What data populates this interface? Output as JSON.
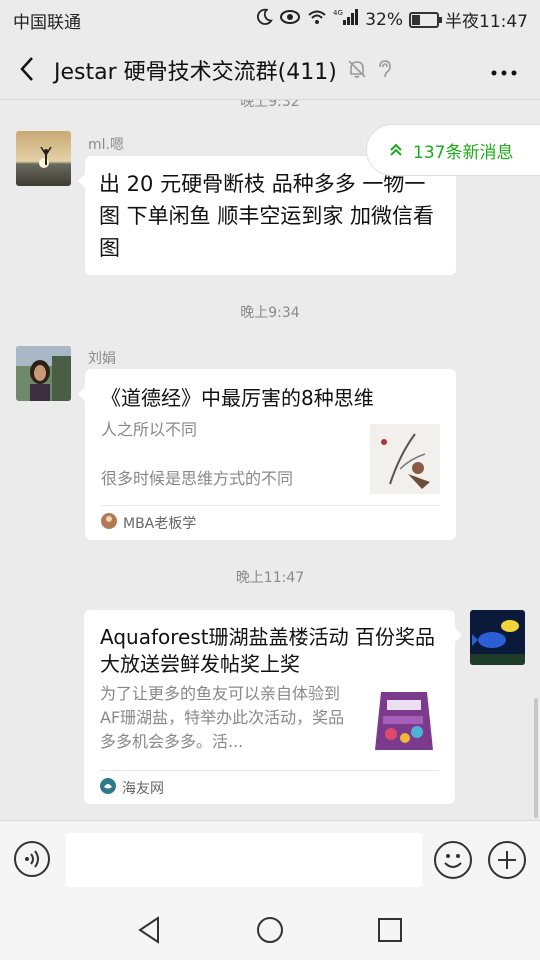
{
  "status_bar": {
    "carrier": "中国联通",
    "signal_label": "4G",
    "battery": "32%",
    "battery_level": 0.32,
    "time": "半夜11:47"
  },
  "header": {
    "title": "Jestar 硬骨技术交流群(411)",
    "back_icon": "back-chevron-icon",
    "mute_icon": "mute-bell-icon",
    "ear_icon": "earpiece-icon",
    "more_icon": "more-dots-icon"
  },
  "new_messages": "137条新消息",
  "partial_time": "晚上9:32",
  "messages": [
    {
      "sender": "ml.嗯",
      "text": "出 20 元硬骨断枝 品种多多 一物一图 下单闲鱼 顺丰空运到家 加微信看图"
    },
    {
      "time": "晚上9:34",
      "sender": "刘娟",
      "card": {
        "title": "《道德经》中最厉害的8种思维",
        "desc_line1": "人之所以不同",
        "desc_line2": "很多时候是思维方式的不同",
        "source": "MBA老板学"
      }
    },
    {
      "time": "晚上11:47",
      "card": {
        "title": "Aquaforest珊湖盐盖楼活动 百份奖品大放送尝鲜发帖奖上奖",
        "desc": "为了让更多的鱼友可以亲自体验到AF珊湖盐，特举办此次活动，奖品多多机会多多。活...",
        "source": "海友网"
      }
    }
  ],
  "input_bar": {
    "placeholder": "",
    "voice_icon": "voice-icon",
    "emoji_icon": "emoji-icon",
    "plus_icon": "plus-icon"
  },
  "nav_bar": {
    "back": "nav-back-icon",
    "home": "nav-home-icon",
    "recents": "nav-recents-icon"
  },
  "colors": {
    "accent_green": "#1aad19",
    "background": "#ebebeb",
    "bubble": "#ffffff"
  }
}
